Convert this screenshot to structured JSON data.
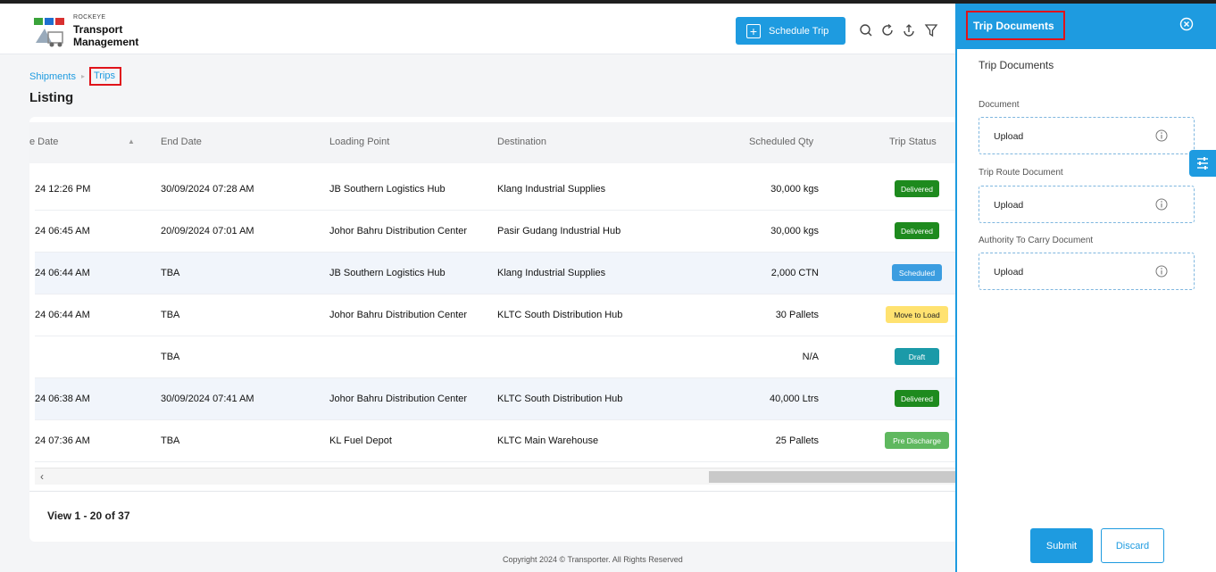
{
  "header": {
    "brand_small": "ROCKEYE",
    "brand_line1": "Transport",
    "brand_line2": "Management",
    "schedule_button": "Schedule Trip",
    "tool_icons": [
      "search-icon",
      "refresh-icon",
      "upload-icon",
      "filter-icon"
    ]
  },
  "breadcrumb": {
    "parent": "Shipments",
    "current": "Trips"
  },
  "page_title": "Listing",
  "table": {
    "columns": [
      "e Date",
      "End Date",
      "Loading Point",
      "Destination",
      "Scheduled Qty",
      "Trip Status"
    ],
    "rows": [
      {
        "start": "24 12:26 PM",
        "end": "30/09/2024 07:28 AM",
        "loading": "JB Southern Logistics Hub",
        "destination": "Klang Industrial Supplies",
        "qty": "30,000 kgs",
        "status": "Delivered",
        "status_color": "#1e8a1e"
      },
      {
        "start": "24 06:45 AM",
        "end": "20/09/2024 07:01 AM",
        "loading": "Johor Bahru Distribution Center",
        "destination": "Pasir Gudang Industrial Hub",
        "qty": "30,000 kgs",
        "status": "Delivered",
        "status_color": "#1e8a1e"
      },
      {
        "start": "24 06:44 AM",
        "end": "TBA",
        "loading": "JB Southern Logistics Hub",
        "destination": "Klang Industrial Supplies",
        "qty": "2,000 CTN",
        "status": "Scheduled",
        "status_color": "#3b9de0"
      },
      {
        "start": "24 06:44 AM",
        "end": "TBA",
        "loading": "Johor Bahru Distribution Center",
        "destination": "KLTC South Distribution Hub",
        "qty": "30 Pallets",
        "status": "Move to Load",
        "status_color": "#ffe270"
      },
      {
        "start": "",
        "end": "TBA",
        "loading": "",
        "destination": "",
        "qty": "N/A",
        "status": "Draft",
        "status_color": "#1b9aa8"
      },
      {
        "start": "24 06:38 AM",
        "end": "30/09/2024 07:41 AM",
        "loading": "Johor Bahru Distribution Center",
        "destination": "KLTC South Distribution Hub",
        "qty": "40,000 Ltrs",
        "status": "Delivered",
        "status_color": "#1e8a1e"
      },
      {
        "start": "24 07:36 AM",
        "end": "TBA",
        "loading": "KL Fuel Depot",
        "destination": "KLTC Main Warehouse",
        "qty": "25 Pallets",
        "status": "Pre Discharge",
        "status_color": "#5fb85f"
      }
    ]
  },
  "pagination": "View 1 - 20 of 37",
  "footer": "Copyright 2024 © Transporter. All Rights Reserved",
  "panel": {
    "title": "Trip Documents",
    "subtitle": "Trip Documents",
    "fields": [
      {
        "label": "Document",
        "placeholder": "Upload"
      },
      {
        "label": "Trip Route Document",
        "placeholder": "Upload"
      },
      {
        "label": "Authority To Carry Document",
        "placeholder": "Upload"
      }
    ],
    "submit": "Submit",
    "discard": "Discard"
  }
}
